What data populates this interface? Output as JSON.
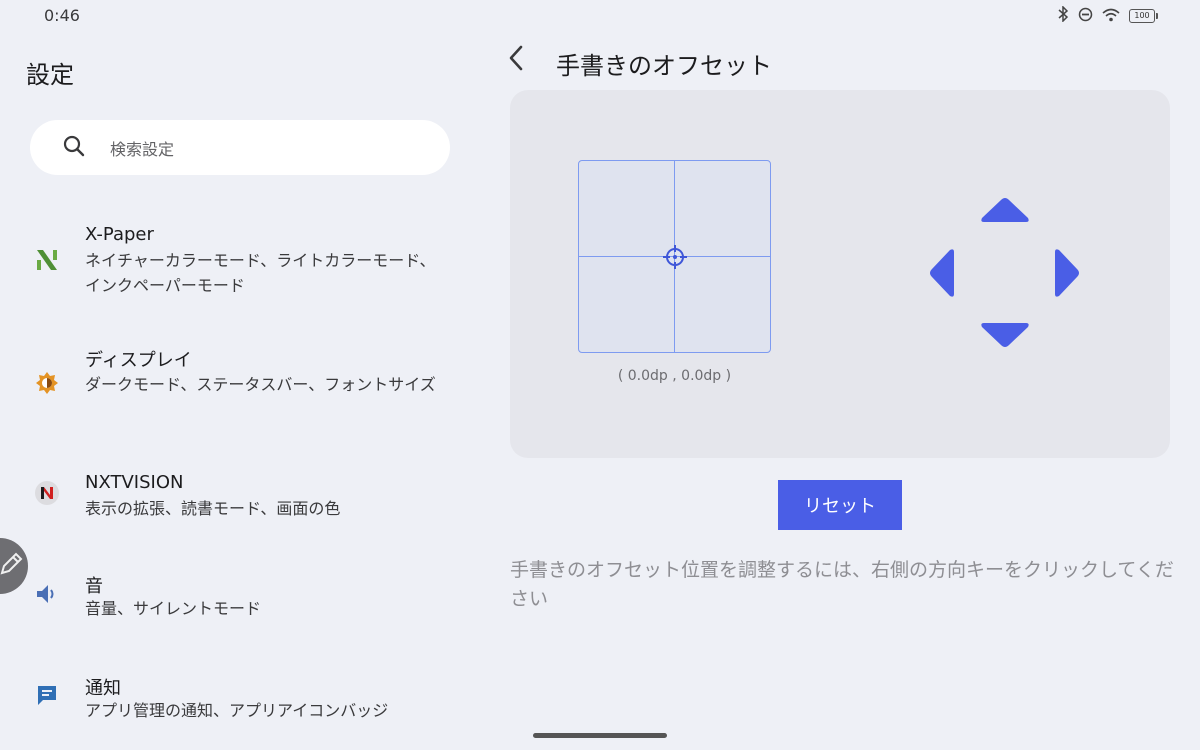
{
  "status_bar": {
    "time": "0:46",
    "battery_level": "100"
  },
  "sidebar": {
    "title": "設定",
    "search": {
      "placeholder": "検索設定"
    },
    "items": [
      {
        "title": "X-Paper",
        "subtitle": "ネイチャーカラーモード、ライトカラーモード、インクペーパーモード",
        "icon": "x-paper-icon",
        "color": "#5a9a3c"
      },
      {
        "title": "ディスプレイ",
        "subtitle": "ダークモード、ステータスバー、フォントサイズ",
        "icon": "brightness-icon",
        "color": "#e08a1e"
      },
      {
        "title": "NXTVISION",
        "subtitle": "表示の拡張、読書モード、画面の色",
        "icon": "nxtvision-icon",
        "color": "#d42020"
      },
      {
        "title": "音",
        "subtitle": "音量、サイレントモード",
        "icon": "speaker-icon",
        "color": "#4a6fb5"
      },
      {
        "title": "通知",
        "subtitle": "アプリ管理の通知、アプリアイコンバッジ",
        "icon": "notification-icon",
        "color": "#2f6fb5"
      }
    ]
  },
  "detail": {
    "title": "手書きのオフセット",
    "coordinates": "( 0.0dp , 0.0dp )",
    "reset_label": "リセット",
    "hint": "手書きのオフセット位置を調整するには、右側の方向キーをクリックしてください",
    "accent_color": "#4a5ee6"
  }
}
